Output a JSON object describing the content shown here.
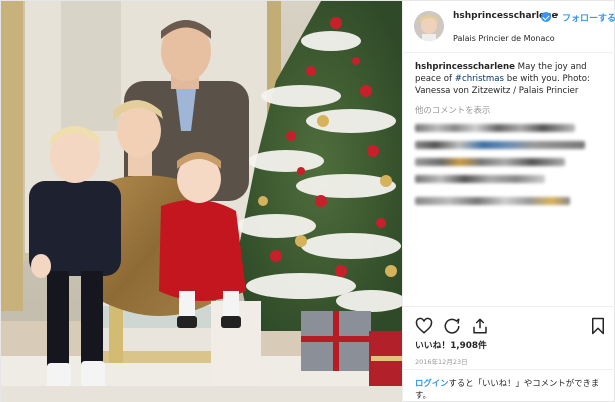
{
  "header": {
    "username": "hshprincesscharlene",
    "separator": "•",
    "follow_label": "フォローする",
    "location": "Palais Princier de Monaco"
  },
  "caption": {
    "username": "hshprincesscharlene",
    "text_before_tag": "May the joy and peace of",
    "hashtag": "#christmas",
    "text_after_tag": "be with you. Photo: Vanessa von Zitzewitz / Palais Princier"
  },
  "comments": {
    "load_more_label": "他のコメントを表示"
  },
  "likes_label": "いいね！1,908件",
  "date_label": "2016年12月23日",
  "login_prompt": {
    "login_link": "ログイン",
    "text": "すると「いいね！」やコメントができます。"
  },
  "icons": {
    "verified": "verified-badge-icon",
    "like": "heart-icon",
    "comment": "comment-icon",
    "share": "share-icon",
    "save": "bookmark-icon"
  },
  "colors": {
    "link_blue": "#3897f0",
    "hashtag": "#003569",
    "text": "#262626",
    "muted": "#999999"
  }
}
